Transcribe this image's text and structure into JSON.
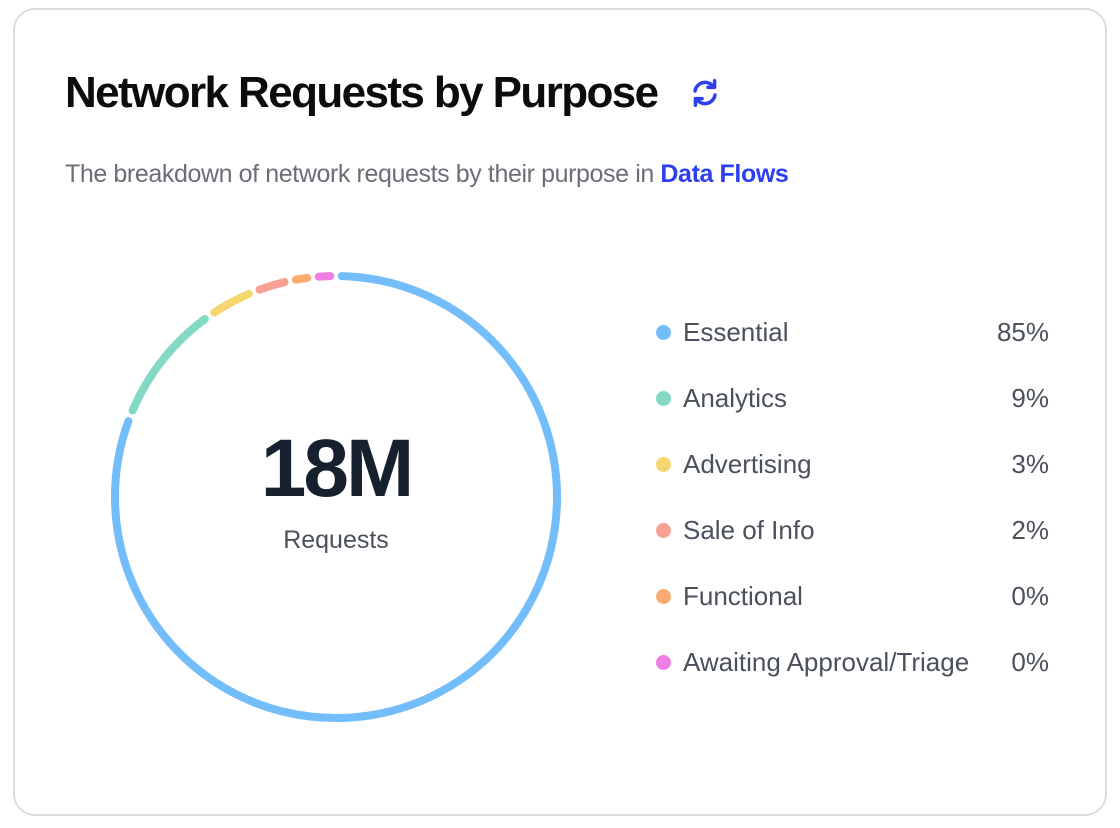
{
  "card": {
    "title": "Network Requests by Purpose",
    "refresh_icon": "refresh-icon",
    "subtitle_prefix": "The breakdown of network requests by their purpose in ",
    "subtitle_link": "Data Flows"
  },
  "colors": {
    "accent": "#2c3ff0",
    "title": "#0c0c0c",
    "text": "#4b515c"
  },
  "chart_data": {
    "type": "pie",
    "style": "donut",
    "center_value": "18M",
    "center_label": "Requests",
    "series": [
      {
        "name": "Essential",
        "value": 85,
        "label": "85%",
        "color": "#74bdfb"
      },
      {
        "name": "Analytics",
        "value": 9,
        "label": "9%",
        "color": "#82d9c4"
      },
      {
        "name": "Advertising",
        "value": 3,
        "label": "3%",
        "color": "#f5d66f"
      },
      {
        "name": "Sale of Info",
        "value": 2,
        "label": "2%",
        "color": "#f7a195"
      },
      {
        "name": "Functional",
        "value": 0,
        "label": "0%",
        "color": "#f9ab72"
      },
      {
        "name": "Awaiting Approval/Triage",
        "value": 0,
        "label": "0%",
        "color": "#ef7fe2"
      }
    ],
    "legend_position": "right"
  }
}
